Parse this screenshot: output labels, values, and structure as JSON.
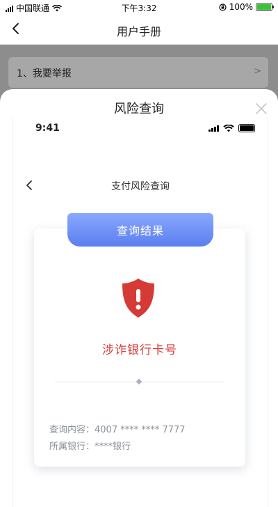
{
  "status_bar": {
    "carrier": "中国联通",
    "time": "下午3:32",
    "battery_percent": "100%"
  },
  "nav": {
    "title": "用户手册"
  },
  "menu": {
    "report_item": "1、我要举报",
    "chevron": ">"
  },
  "sheet": {
    "title": "风险查询",
    "inner": {
      "time": "9:41",
      "page_title": "支付风险查询",
      "ribbon_label": "查询结果",
      "result_label": "涉诈银行卡号",
      "query_content_label": "查询内容：",
      "query_content_value": "4007 **** **** 7777",
      "bank_label": "所属银行：",
      "bank_value": "****银行"
    }
  },
  "colors": {
    "danger": "#d63a36",
    "ribbon_blue": "#6b8cf5",
    "battery_green": "#38c23a"
  }
}
